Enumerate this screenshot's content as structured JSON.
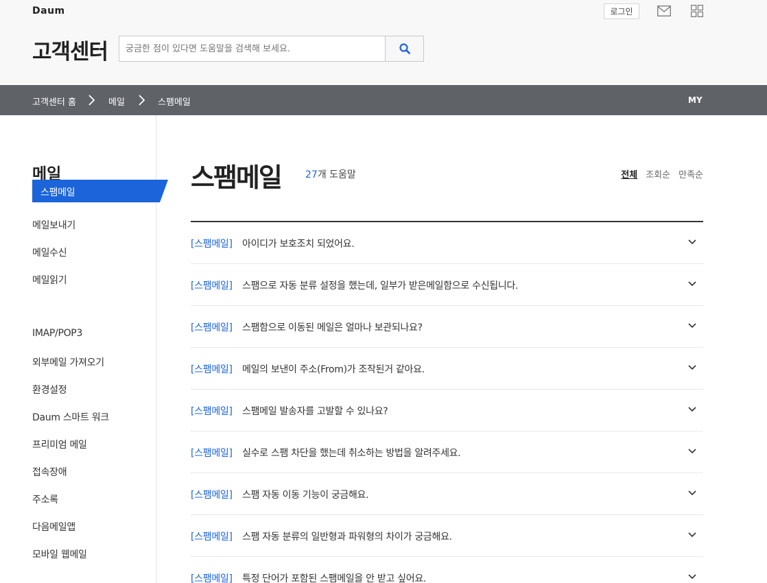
{
  "header": {
    "logo": "Daum",
    "login_label": "로그인",
    "mail_icon": "mail-icon",
    "apps_icon": "apps-grid-icon",
    "site_title": "고객센터",
    "search_placeholder": "궁금한 점이 있다면 도움말을 검색해 보세요.",
    "search_icon": "search-icon",
    "accent_color": "#1b64da"
  },
  "breadcrumb": {
    "items": [
      "고객센터 홈",
      "메일",
      "스팸메일"
    ],
    "my_label": "MY",
    "bar_color": "#5f6368"
  },
  "sidebar": {
    "title": "메일",
    "items": [
      "메일보내기",
      "메일수신",
      "메일읽기",
      "스팸메일",
      "IMAP/POP3",
      "외부메일 가져오기",
      "환경설정",
      "Daum 스마트 워크",
      "프리미엄 메일",
      "접속장애",
      "주소록",
      "다음메일앱",
      "모바일 웹메일"
    ],
    "active_index": 3,
    "active_color": "#1b64da"
  },
  "main": {
    "title": "스팸메일",
    "count_num": "27",
    "count_suffix": "개 도움말",
    "sorts": [
      "전체",
      "조회순",
      "만족순"
    ],
    "active_sort": "전체",
    "faq_tag": "[스팸메일]",
    "faqs": [
      "아이디가 보호조치 되었어요.",
      "스팸으로 자동 분류 설정을 했는데, 일부가 받은메일함으로 수신됩니다.",
      "스팸함으로 이동된 메일은 얼마나 보관되나요?",
      "메일의 보낸이 주소(From)가 조작된거 같아요.",
      "스팸메일 발송자를 고발할 수 있나요?",
      "실수로 스팸 차단을 했는데 취소하는 방법을 알려주세요.",
      "스팸 자동 이동 기능이 궁금해요.",
      "스팸 자동 분류의 일반형과 파워형의 차이가 궁금해요.",
      "특정 단어가 포함된 스팸메일을 안 받고 싶어요."
    ]
  }
}
